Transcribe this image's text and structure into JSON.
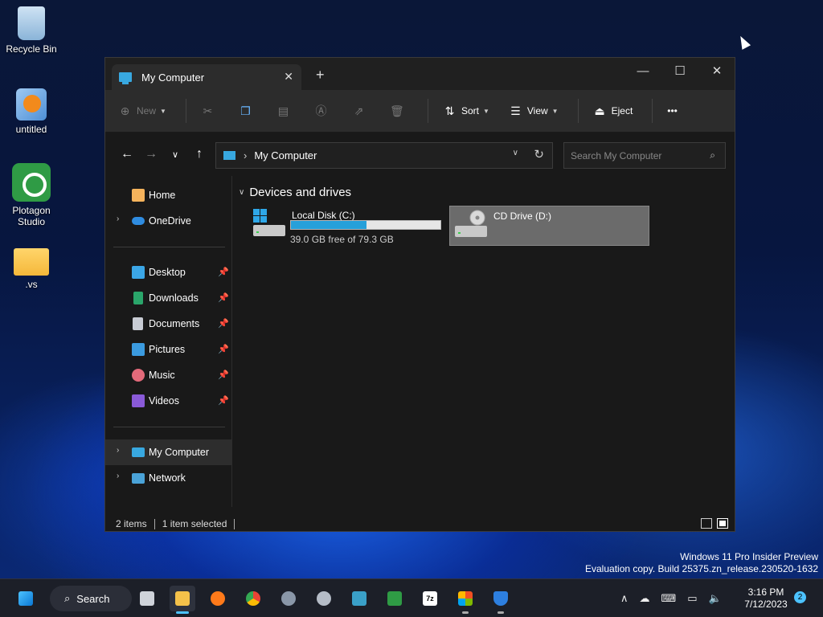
{
  "desktop": {
    "icons": [
      {
        "label": "Recycle Bin"
      },
      {
        "label": "untitled"
      },
      {
        "label": "Plotagon Studio"
      },
      {
        "label": ".vs"
      }
    ]
  },
  "window": {
    "tab_title": "My Computer",
    "toolbar": {
      "new_label": "New",
      "sort_label": "Sort",
      "view_label": "View",
      "eject_label": "Eject",
      "more_label": "•••"
    },
    "address": {
      "path": "My Computer",
      "search_placeholder": "Search My Computer"
    },
    "sidebar": {
      "items": [
        {
          "label": "Home"
        },
        {
          "label": "OneDrive"
        },
        {
          "label": "Desktop"
        },
        {
          "label": "Downloads"
        },
        {
          "label": "Documents"
        },
        {
          "label": "Pictures"
        },
        {
          "label": "Music"
        },
        {
          "label": "Videos"
        },
        {
          "label": "My Computer"
        },
        {
          "label": "Network"
        }
      ]
    },
    "content": {
      "group_title": "Devices and drives",
      "drives": [
        {
          "name": "Local Disk (C:)",
          "free_text": "39.0 GB free of 79.3 GB",
          "used_fraction": 0.508
        },
        {
          "name": "CD Drive (D:)"
        }
      ]
    },
    "status": {
      "items": "2 items",
      "selected": "1 item selected"
    }
  },
  "watermark": {
    "line1": "Windows 11 Pro Insider Preview",
    "line2": "Evaluation copy. Build 25375.zn_release.230520-1632"
  },
  "taskbar": {
    "search_label": "Search",
    "time": "3:16 PM",
    "date": "7/12/2023",
    "notification_count": "2"
  },
  "colors": {
    "accent": "#4cc2ff",
    "storage_bar": "#26a0da",
    "selected_drive": "#6b6b6b"
  }
}
